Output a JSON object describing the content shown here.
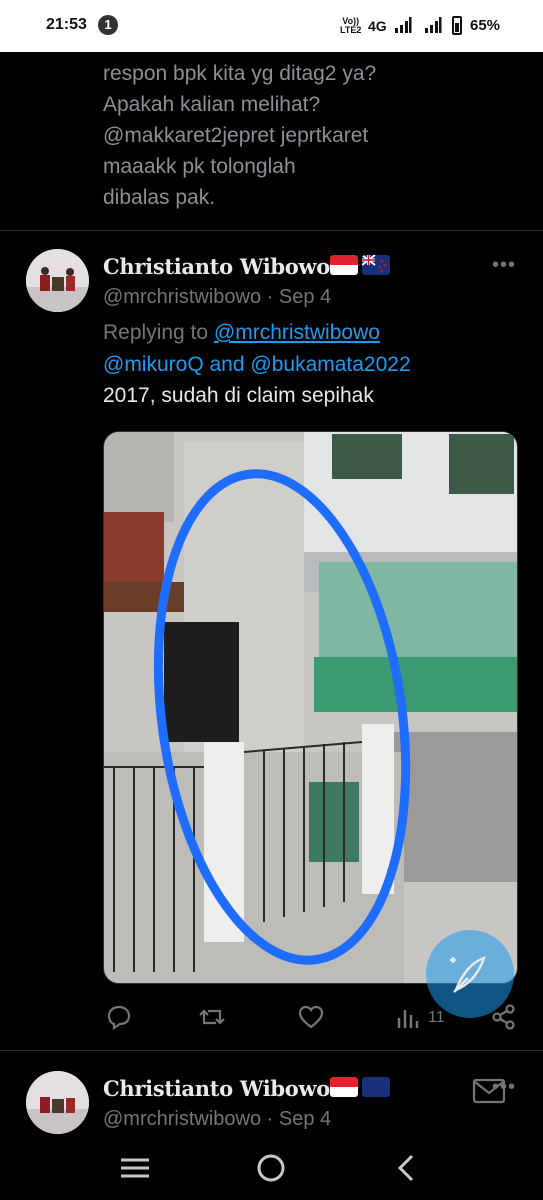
{
  "status_bar": {
    "time": "21:53",
    "notification_count": "1",
    "volte_top": "Vo))",
    "volte_bottom": "LTE2",
    "network": "4G",
    "battery": "65%"
  },
  "previous_tweet": {
    "text": "respon bpk kita yg ditag2 ya?\nApakah kalian melihat?\n@makkaret2jepret  jeprtkaret\nmaaakk   pk tolonglah\ndibalas pak."
  },
  "tweet": {
    "author_name": "Christianto Wibowo",
    "flags": [
      "indonesia-flag",
      "new-zealand-flag"
    ],
    "handle": "@mrchristwibowo",
    "separator": "·",
    "date": "Sep 4",
    "replying_prefix": "Replying to ",
    "reply_mention_1": "@mrchristwibowo",
    "reply_mention_2": "@mikuroQ",
    "reply_and": " and ",
    "reply_mention_3": "@bukamata2022",
    "text": "2017, sudah di claim sepihak",
    "image_description_icon": "photo-of-house-with-gate",
    "views_count": "11",
    "accent_color": "#1d9bf0"
  },
  "next_tweet": {
    "author_name": "Christianto Wibowo",
    "handle": "@mrchristwibowo",
    "separator": "·",
    "date": "Sep 4"
  },
  "icons": {
    "more": "more-options-icon",
    "reply": "reply-icon",
    "retweet": "retweet-icon",
    "like": "like-icon",
    "views": "views-icon",
    "share": "share-icon",
    "compose": "compose-feather-icon",
    "nav_recents": "recents-icon",
    "nav_home": "home-circle-icon",
    "nav_back": "back-icon"
  }
}
